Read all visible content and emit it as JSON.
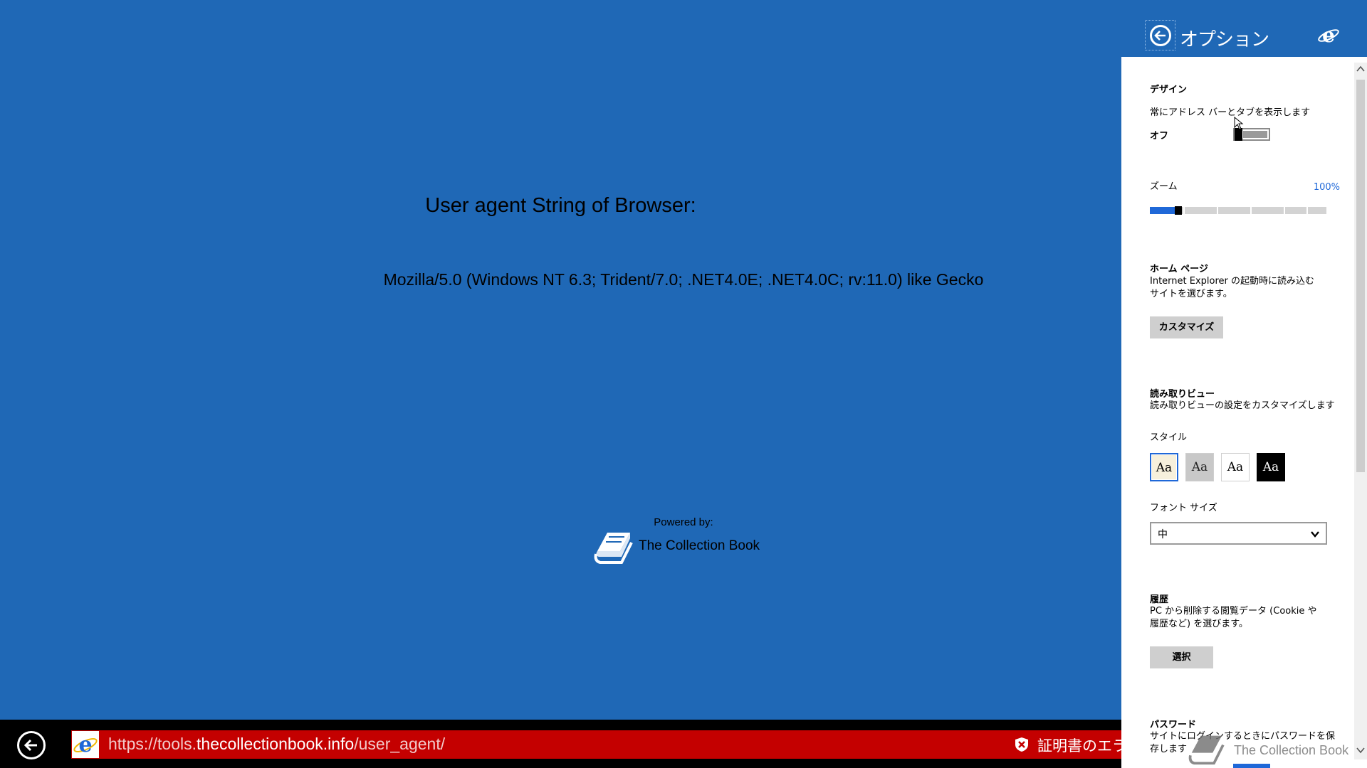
{
  "page": {
    "heading": "User agent String of Browser:",
    "ua_string": "Mozilla/5.0 (Windows NT 6.3; Trident/7.0; .NET4.0E; .NET4.0C; rv:11.0) like Gecko",
    "powered_by": "Powered by:",
    "brand_name": "The Collection Book",
    "brand_icon": "book-icon"
  },
  "address_bar": {
    "url_prefix": "https://tools.",
    "url_domain": "thecollectionbook.info",
    "url_path": "/user_agent/",
    "cert_error": "証明書のエラー",
    "back_icon": "back-arrow-icon",
    "site_icon": "ie-icon",
    "cert_icon": "shield-error-icon"
  },
  "options": {
    "title": "オプション",
    "back_icon": "back-arrow-icon",
    "app_icon": "ie-icon",
    "design": {
      "heading": "デザイン",
      "always_show_label": "常にアドレス バーとタブを表示します",
      "toggle_state": "オフ",
      "toggle_on": false
    },
    "zoom": {
      "label": "ズーム",
      "value": "100%",
      "level": 0.16
    },
    "home_page": {
      "heading": "ホーム ページ",
      "line1": "Internet Explorer の起動時に読み込む",
      "line2": "サイトを選びます。",
      "button": "カスタマイズ"
    },
    "reading_view": {
      "heading": "読み取りビュー",
      "description": "読み取りビューの設定をカスタマイズします",
      "style_label": "スタイル",
      "styles": [
        {
          "label": "Aa",
          "bg": "#f6f0dc",
          "fg": "#000000",
          "selected": true
        },
        {
          "label": "Aa",
          "bg": "#c8c8c8",
          "fg": "#222222",
          "selected": false
        },
        {
          "label": "Aa",
          "bg": "#ffffff",
          "fg": "#000000",
          "selected": false
        },
        {
          "label": "Aa",
          "bg": "#000000",
          "fg": "#ffffff",
          "selected": false
        }
      ],
      "font_size_label": "フォント サイズ",
      "font_size_value": "中"
    },
    "history": {
      "heading": "履歴",
      "line1": "PC から削除する閲覧データ (Cookie や",
      "line2": "履歴など) を選びます。",
      "button": "選択"
    },
    "password": {
      "heading": "パスワード",
      "line1": "サイトにログインするときにパスワードを保",
      "line2": "存します"
    },
    "watermark": "The Collection Book"
  },
  "colors": {
    "page_bg": "#1f68b6",
    "address_error": "#c40000",
    "accent": "#1f68d8"
  }
}
